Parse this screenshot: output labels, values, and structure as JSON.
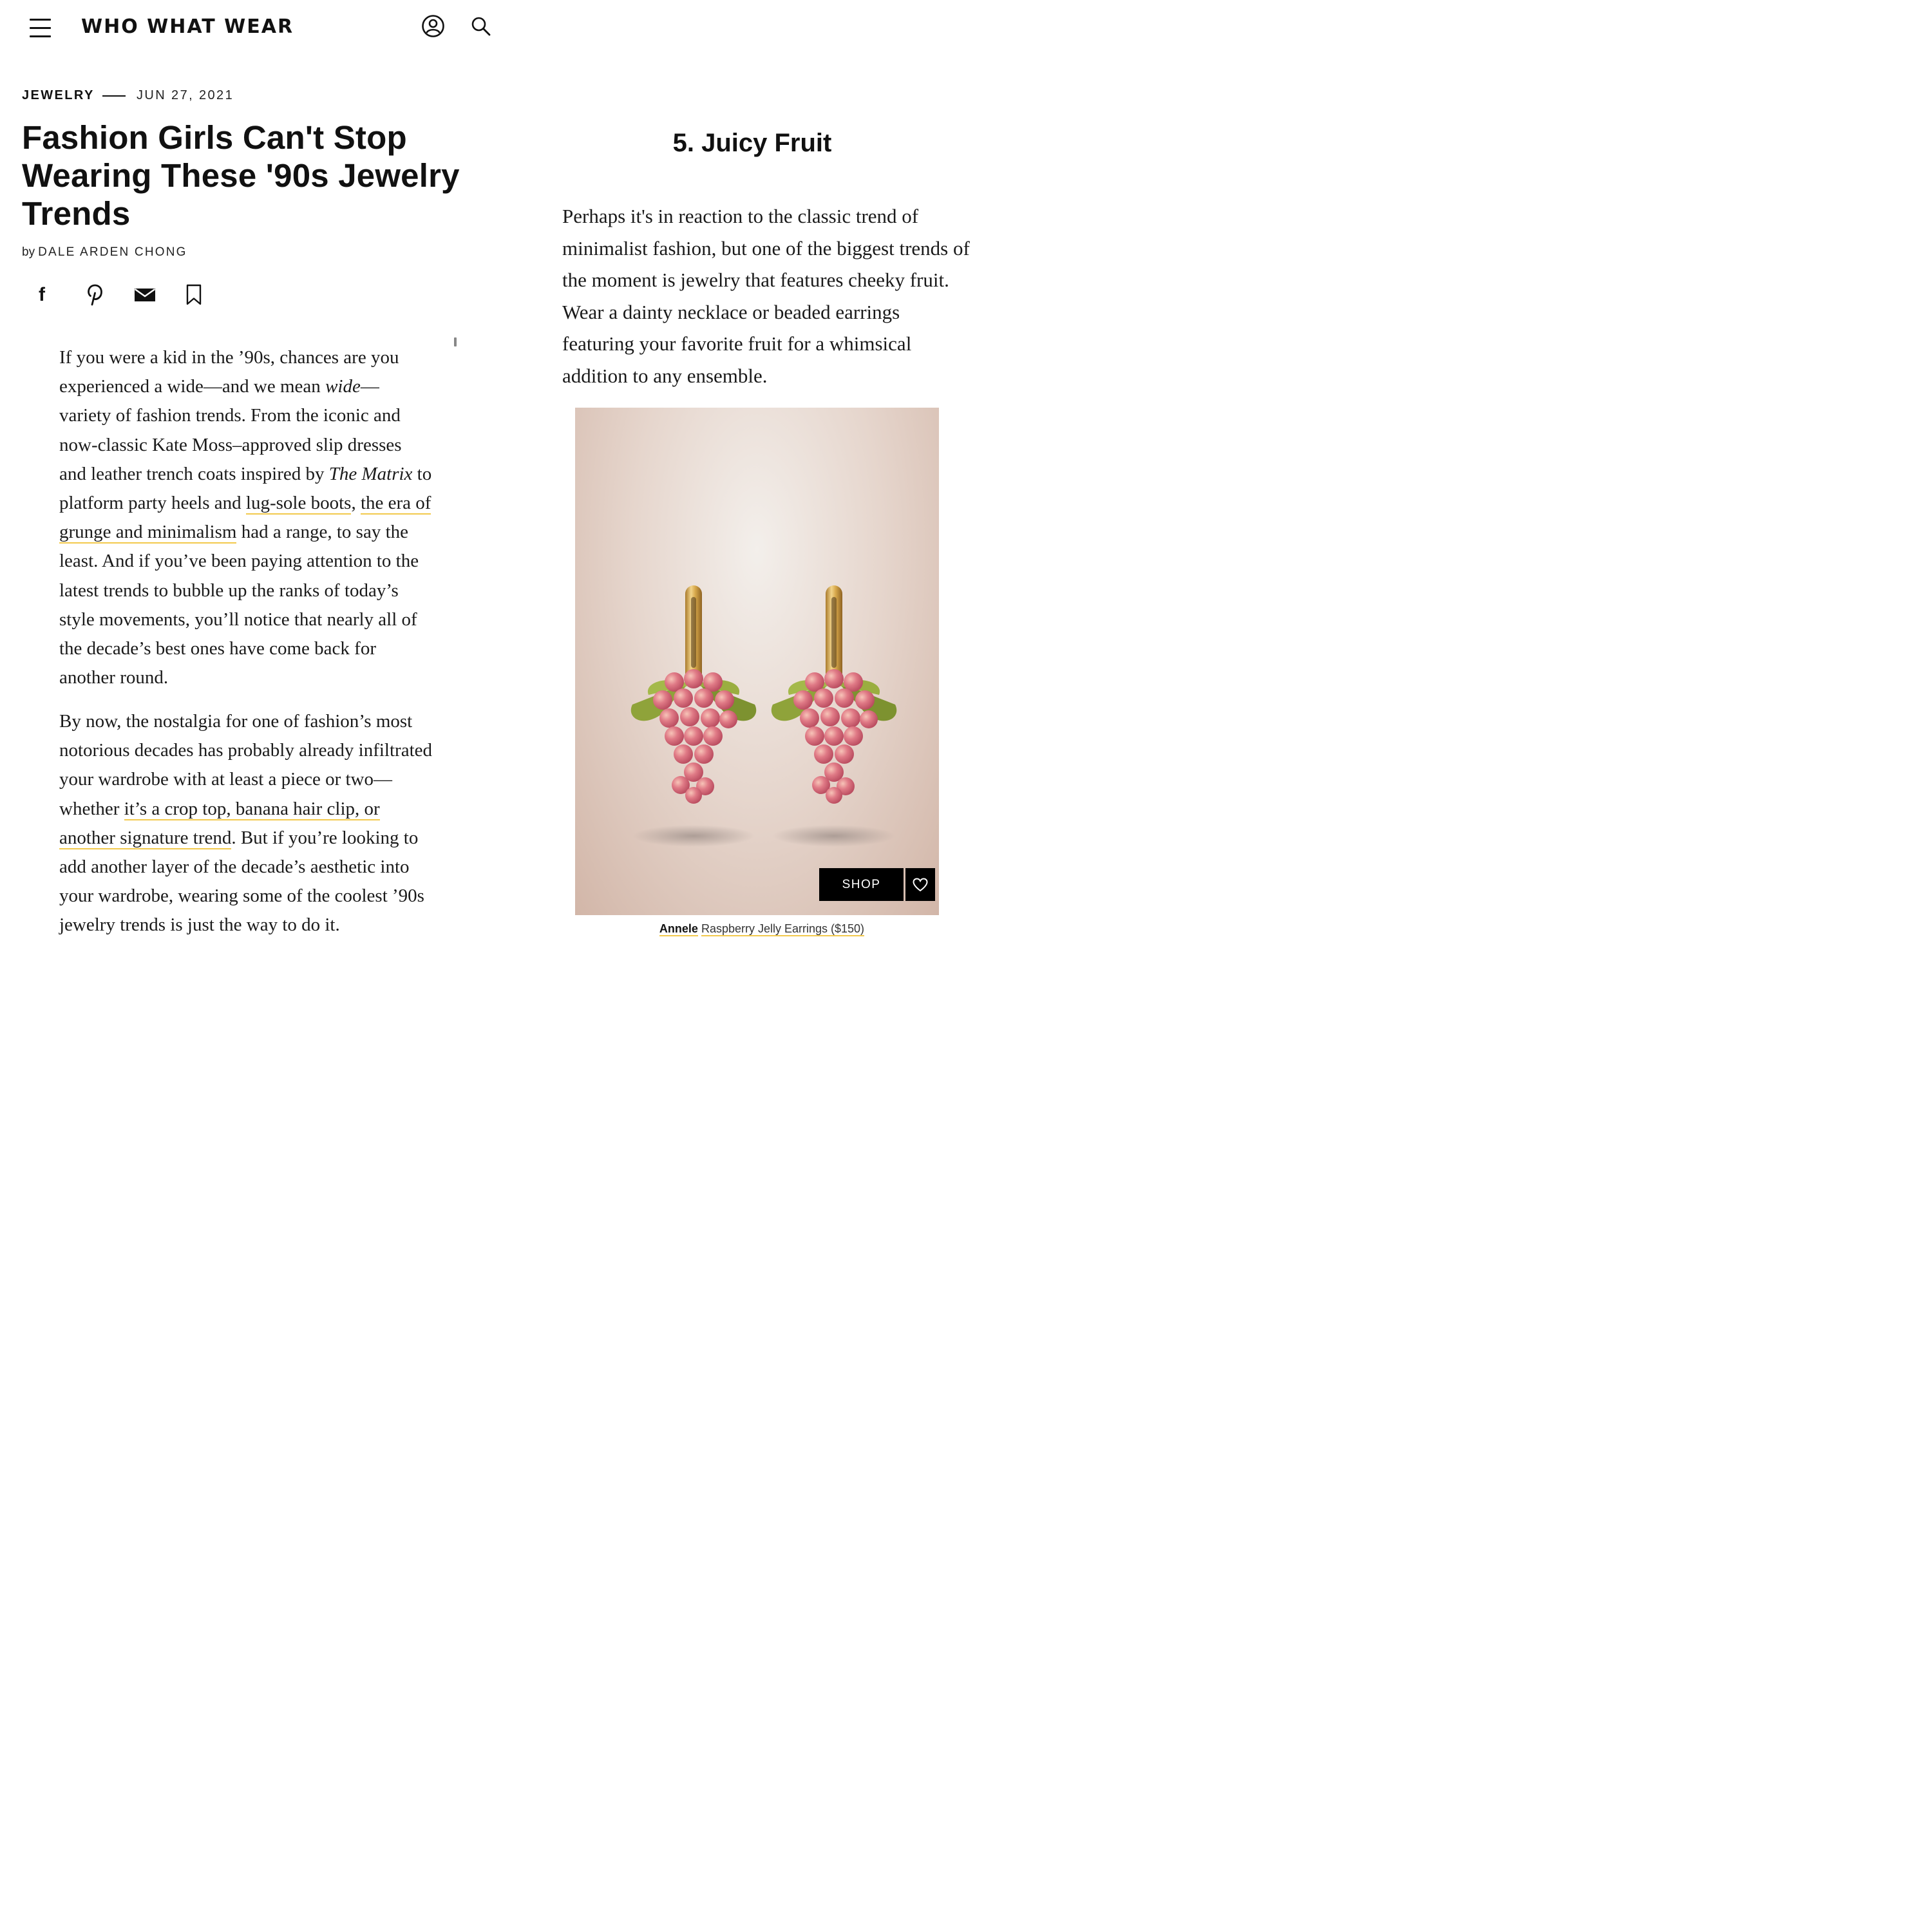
{
  "header": {
    "logo": "WHO WHAT WEAR",
    "icons": [
      "hamburger-menu-icon",
      "account-icon",
      "search-icon"
    ]
  },
  "article": {
    "category": "JEWELRY",
    "date": "JUN 27, 2021",
    "title_lines": [
      "Fashion Girls Can't Stop",
      "Wearing These '90s Jewelry",
      "Trends"
    ],
    "byline_prefix": "by",
    "author": "DALE ARDEN CHONG",
    "share_icons": [
      "facebook-icon",
      "pinterest-icon",
      "email-icon",
      "bookmark-icon"
    ],
    "para1": {
      "t1": "If you were a kid in the ’90s, chances are you experienced a wide—and we mean ",
      "em1": "wide",
      "t2": "— variety of fashion trends. From the iconic and now-classic Kate Moss–approved slip dresses and leather trench coats inspired by ",
      "em2": "The Matrix",
      "t3": " to platform party heels and ",
      "link1": "lug-sole boots",
      "t4": ", ",
      "link2": "the era of grunge and minimalism",
      "t5": " had a range, to say the least. And if you’ve been paying attention to the latest trends to bubble up the ranks of today’s style movements, you’ll notice that nearly all of the decade’s best ones have come back for another round."
    },
    "para2": {
      "t1": "By now, the nostalgia for one of fashion’s most notorious decades has probably already infiltrated your wardrobe with at least a piece or two—whether ",
      "link1": "it’s a crop top, banana hair clip, or another signature trend",
      "t2": ". But if you’re looking to add another layer of the decade’s aesthetic into your wardrobe, wearing some of the coolest ’90s jewelry trends is just the way to do it."
    }
  },
  "section": {
    "heading": "5. Juicy Fruit",
    "text": "Perhaps it's in reaction to the classic trend of minimalist fashion, but one of the biggest trends of the moment is jewelry that features cheeky fruit. Wear a dainty necklace or beaded earrings featuring your favorite fruit for a whimsical addition to any ensemble.",
    "shop_label": "SHOP",
    "fav_icon": "heart-icon",
    "caption": {
      "brand": "Annele",
      "product": "Raspberry Jelly Earrings ($150)"
    }
  },
  "colors": {
    "link_underline": "#f2c94c",
    "photo_bg": "#e6d6cd",
    "grape": "#e07a86",
    "leaf": "#8fa33a",
    "gold": "#d7a84b"
  }
}
